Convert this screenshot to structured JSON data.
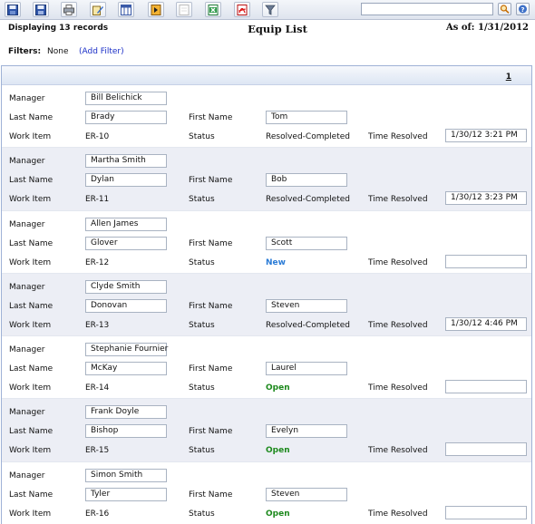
{
  "toolbar": {
    "icons": [
      "save-icon",
      "save-as-icon",
      "print-icon",
      "edit-icon",
      "columns-icon",
      "export-icon",
      "report-icon",
      "excel-icon",
      "pdf-icon",
      "filter-icon"
    ],
    "search_value": "",
    "search_go_icon": "search-icon",
    "help_icon": "help-icon"
  },
  "header": {
    "count_text": "Displaying 13 records",
    "title": "Equip List",
    "as_of": "As of: 1/31/2012",
    "filters_label": "Filters:",
    "filters_value": "None",
    "add_filter": "(Add Filter)"
  },
  "pager": {
    "page": "1"
  },
  "labels": {
    "manager": "Manager",
    "last_name": "Last Name",
    "first_name": "First Name",
    "work_item": "Work Item",
    "status": "Status",
    "time_resolved": "Time Resolved"
  },
  "records": [
    {
      "manager": "Bill Belichick",
      "last_name": "Brady",
      "first_name": "Tom",
      "work_item": "ER-10",
      "status": "Resolved-Completed",
      "time_resolved": "1/30/12 3:21 PM"
    },
    {
      "manager": "Martha Smith",
      "last_name": "Dylan",
      "first_name": "Bob",
      "work_item": "ER-11",
      "status": "Resolved-Completed",
      "time_resolved": "1/30/12 3:23 PM"
    },
    {
      "manager": "Allen James",
      "last_name": "Glover",
      "first_name": "Scott",
      "work_item": "ER-12",
      "status": "New",
      "time_resolved": ""
    },
    {
      "manager": "Clyde Smith",
      "last_name": "Donovan",
      "first_name": "Steven",
      "work_item": "ER-13",
      "status": "Resolved-Completed",
      "time_resolved": "1/30/12 4:46 PM"
    },
    {
      "manager": "Stephanie Fournier",
      "last_name": "McKay",
      "first_name": "Laurel",
      "work_item": "ER-14",
      "status": "Open",
      "time_resolved": ""
    },
    {
      "manager": "Frank Doyle",
      "last_name": "Bishop",
      "first_name": "Evelyn",
      "work_item": "ER-15",
      "status": "Open",
      "time_resolved": ""
    },
    {
      "manager": "Simon Smith",
      "last_name": "Tyler",
      "first_name": "Steven",
      "work_item": "ER-16",
      "status": "Open",
      "time_resolved": ""
    }
  ]
}
